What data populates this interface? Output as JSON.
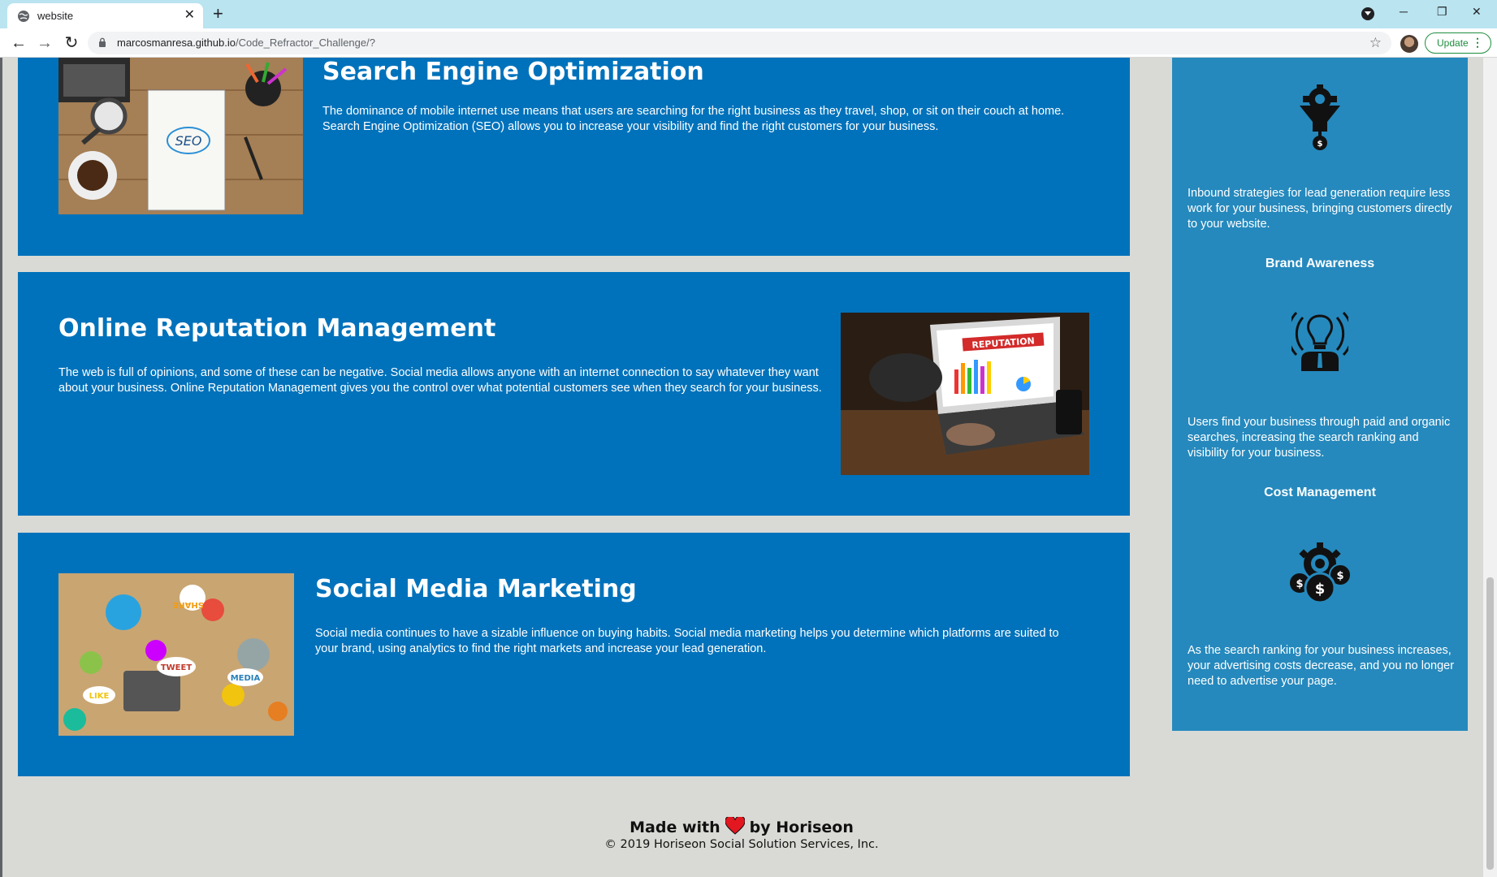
{
  "browser": {
    "tab_title": "website",
    "new_tab": "+",
    "url_host": "marcosmanresa.github.io",
    "url_path": "/Code_Refractor_Challenge/?",
    "update_label": "Update"
  },
  "sections": [
    {
      "title": "Search Engine Optimization",
      "body": "The dominance of mobile internet use means that users are searching for the right business as they travel, shop, or sit on their couch at home. Search Engine Optimization (SEO) allows you to increase your visibility and find the right customers for your business.",
      "image_text": "SEO"
    },
    {
      "title": "Online Reputation Management",
      "body": "The web is full of opinions, and some of these can be negative. Social media allows anyone with an internet connection to say whatever they want about your business. Online Reputation Management gives you the control over what potential customers see when they search for your business.",
      "image_text": "REPUTATION"
    },
    {
      "title": "Social Media Marketing",
      "body": "Social media continues to have a sizable influence on buying habits. Social media marketing helps you determine which platforms are suited to your brand, using analytics to find the right markets and increase your lead generation.",
      "image_labels": [
        "SHARE",
        "TWEET",
        "LIKE",
        "MEDIA"
      ]
    }
  ],
  "benefits": [
    {
      "title": "",
      "icon": "lead-funnel-icon",
      "body": "Inbound strategies for lead generation require less work for your business, bringing customers directly to your website."
    },
    {
      "title": "Brand Awareness",
      "icon": "lightbulb-broadcast-icon",
      "body": "Users find your business through paid and organic searches, increasing the search ranking and visibility for your business."
    },
    {
      "title": "Cost Management",
      "icon": "gear-coins-icon",
      "body": "As the search ranking for your business increases, your advertising costs decrease, and you no longer need to advertise your page."
    }
  ],
  "footer": {
    "made_with": "Made with",
    "by": "by Horiseon",
    "copyright": "© 2019 Horiseon Social Solution Services, Inc."
  },
  "colors": {
    "card": "#0072bb",
    "aside": "#2589bd",
    "page_bg": "#d9dad5",
    "heart": "#e3171f"
  }
}
